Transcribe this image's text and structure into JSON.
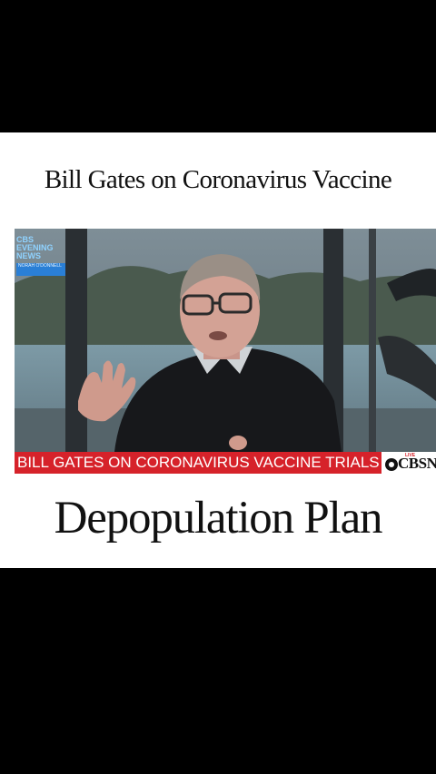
{
  "post": {
    "title_top": "Bill Gates on Coronavirus Vaccine",
    "title_bottom": "Depopulation Plan"
  },
  "video": {
    "news_logo": {
      "line1": "CBS",
      "line2": "EVENING",
      "line3": "NEWS",
      "anchor": "NORAH O'DONNELL"
    },
    "lower_third": "BILL GATES ON CORONAVIRUS VACCINE TRIALS",
    "live_label": "LIVE",
    "network": "CBSN"
  },
  "colors": {
    "chyron_red": "#d6222a",
    "background": "#000000",
    "card": "#ffffff"
  }
}
